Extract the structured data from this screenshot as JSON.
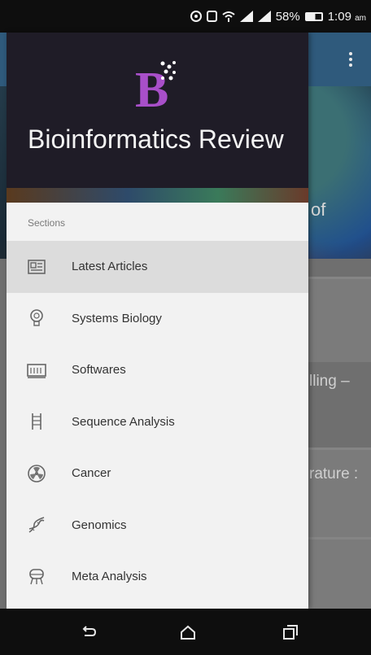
{
  "status_bar": {
    "battery": "58%",
    "time": "1:09",
    "time_suffix": "am"
  },
  "background_app": {
    "hero_text_fragment": "of",
    "card_fragments": [
      "lling –",
      "rature :"
    ]
  },
  "drawer": {
    "logo_letter": "B",
    "title": "Bioinformatics Review",
    "section_label": "Sections",
    "items": [
      {
        "label": "Latest Articles",
        "icon": "newspaper-icon",
        "active": true
      },
      {
        "label": "Systems Biology",
        "icon": "lightbulb-icon",
        "active": false
      },
      {
        "label": "Softwares",
        "icon": "keyboard-icon",
        "active": false
      },
      {
        "label": "Sequence Analysis",
        "icon": "dna-ladder-icon",
        "active": false
      },
      {
        "label": "Cancer",
        "icon": "radiation-icon",
        "active": false
      },
      {
        "label": "Genomics",
        "icon": "dna-helix-icon",
        "active": false
      },
      {
        "label": "Meta Analysis",
        "icon": "robot-icon",
        "active": false
      }
    ]
  },
  "colors": {
    "accent": "#a84fc9",
    "header_bg": "#1f1c27",
    "drawer_bg": "#f2f2f2",
    "active_bg": "#dcdcdc"
  }
}
